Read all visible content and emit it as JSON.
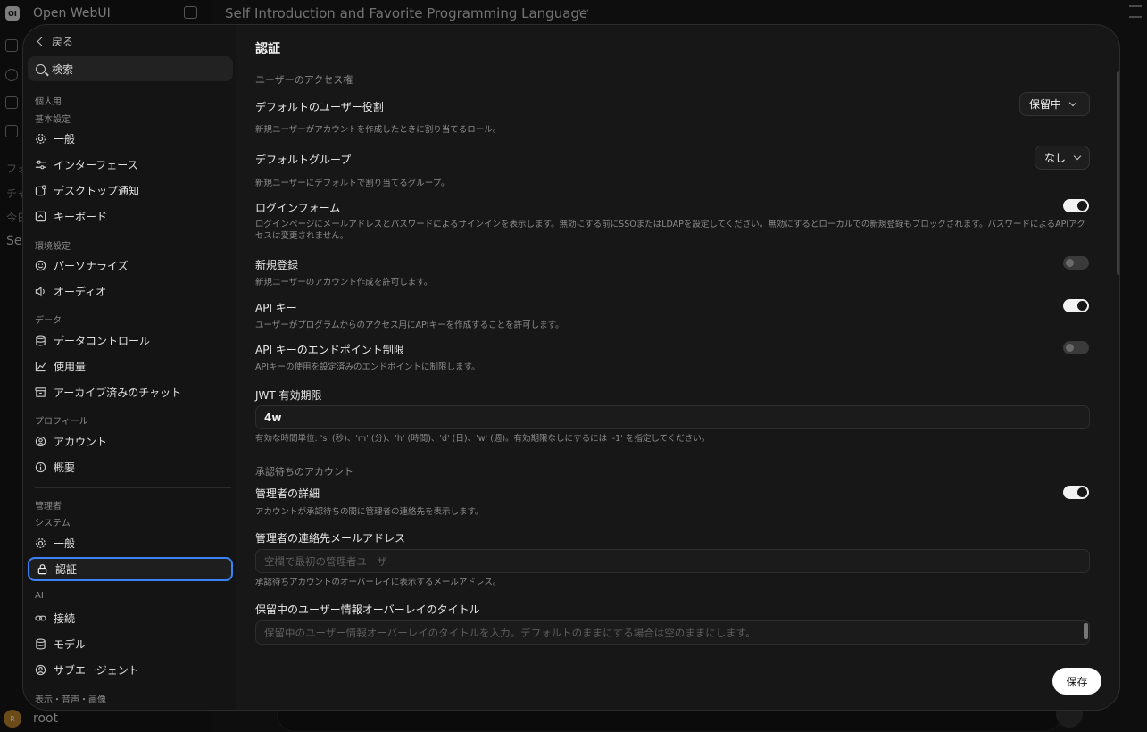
{
  "background": {
    "brand": "Open WebUI",
    "logo": "OI",
    "chat_title": "Self Introduction and Favorite Programming Language",
    "more": "⋯",
    "sidebar_partials": [
      "フォ",
      "チャ",
      "今日",
      "Se"
    ],
    "user": {
      "initial": "R",
      "name": "root"
    }
  },
  "nav": {
    "back_label": "戻る",
    "search_label": "検索",
    "sections": {
      "personal": "個人用",
      "basic": "基本設定",
      "environment": "環境設定",
      "data": "データ",
      "profile": "プロフィール",
      "admin": "管理者",
      "system": "システム",
      "ai": "AI",
      "media": "表示・音声・画像"
    },
    "items": {
      "general": "一般",
      "interface": "インターフェース",
      "notifications": "デスクトップ通知",
      "keyboard": "キーボード",
      "personalize": "パーソナライズ",
      "audio": "オーディオ",
      "data_controls": "データコントロール",
      "usage": "使用量",
      "archived": "アーカイブ済みのチャット",
      "account": "アカウント",
      "about": "概要",
      "admin_general": "一般",
      "auth": "認証",
      "connections": "接続",
      "models": "モデル",
      "subagents": "サブエージェント"
    }
  },
  "content": {
    "title": "認証",
    "section_access": "ユーザーのアクセス権",
    "default_role": {
      "label": "デフォルトのユーザー役割",
      "desc": "新規ユーザーがアカウントを作成したときに割り当てるロール。",
      "value": "保留中"
    },
    "default_group": {
      "label": "デフォルトグループ",
      "desc": "新規ユーザーにデフォルトで割り当てるグループ。",
      "value": "なし"
    },
    "login_form": {
      "label": "ログインフォーム",
      "desc": "ログインページにメールアドレスとパスワードによるサインインを表示します。無効にする前にSSOまたはLDAPを設定してください。無効にするとローカルでの新規登録もブロックされます。パスワードによるAPIアクセスは変更されません。",
      "enabled": true
    },
    "signup": {
      "label": "新規登録",
      "desc": "新規ユーザーのアカウント作成を許可します。",
      "enabled": false
    },
    "api_keys": {
      "label": "API キー",
      "desc": "ユーザーがプログラムからのアクセス用にAPIキーを作成することを許可します。",
      "enabled": true
    },
    "api_endpoint_limit": {
      "label": "API キーのエンドポイント制限",
      "desc": "APIキーの使用を設定済みのエンドポイントに制限します。",
      "enabled": false
    },
    "jwt": {
      "label": "JWT 有効期限",
      "value": "4w",
      "desc": "有効な時間単位: 's' (秒)、'm' (分)、'h' (時間)、'd' (日)、'w' (週)。有効期限なしにするには '-1' を指定してください。"
    },
    "section_pending": "承認待ちのアカウント",
    "admin_details": {
      "label": "管理者の詳細",
      "desc": "アカウントが承認待ちの間に管理者の連絡先を表示します。",
      "enabled": true
    },
    "admin_email": {
      "label": "管理者の連絡先メールアドレス",
      "placeholder": "空欄で最初の管理者ユーザー",
      "desc": "承認待ちアカウントのオーバーレイに表示するメールアドレス。"
    },
    "pending_title": {
      "label": "保留中のユーザー情報オーバーレイのタイトル",
      "placeholder": "保留中のユーザー情報オーバーレイのタイトルを入力。デフォルトのままにする場合は空のままにします。"
    },
    "save_label": "保存"
  }
}
